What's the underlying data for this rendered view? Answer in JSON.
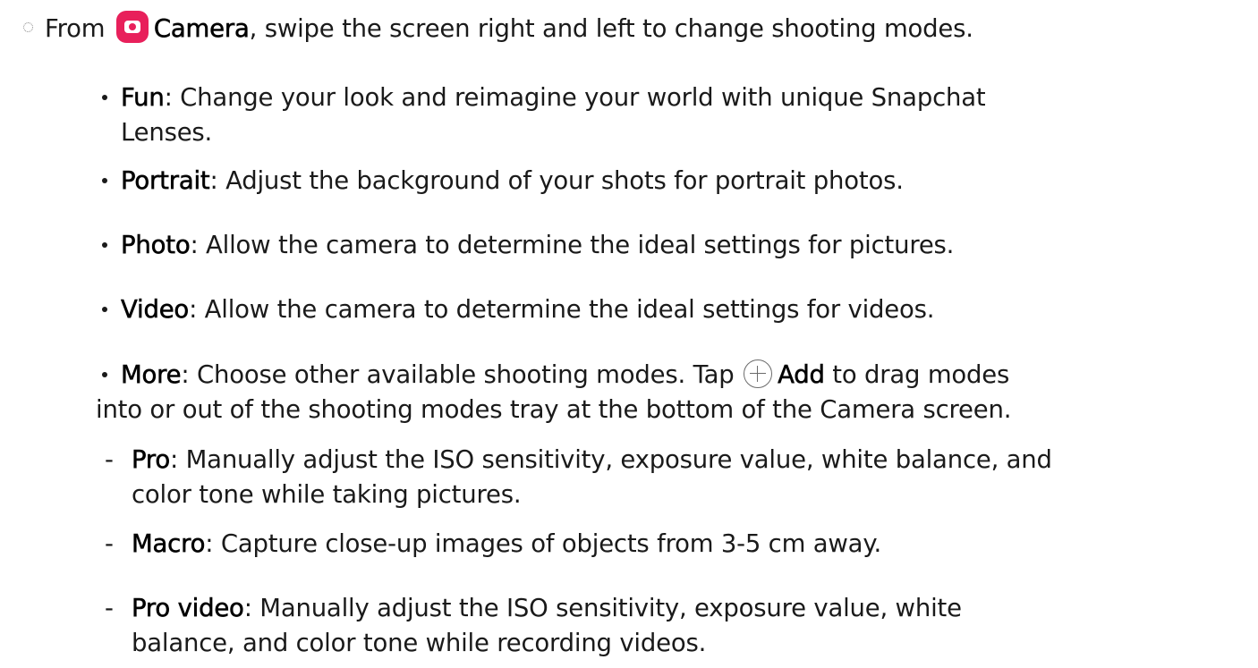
{
  "intro": {
    "prefix": "From",
    "app_icon": "camera-app-icon",
    "app_name": "Camera",
    "rest": ", swipe the screen right and left to change shooting modes."
  },
  "modes": [
    {
      "term": "Fun",
      "desc_line1": ": Change your look and reimagine your world with unique Snapchat",
      "desc_line2": "Lenses."
    },
    {
      "term": "Portrait",
      "desc_line1": ": Adjust the background of your shots for portrait photos."
    },
    {
      "term": "Photo",
      "desc_line1": ": Allow the camera to determine the ideal settings for pictures."
    },
    {
      "term": "Video",
      "desc_line1": ": Allow the camera to determine the ideal settings for videos."
    },
    {
      "term": "More",
      "desc_pre_icon": ": Choose other available shooting modes. Tap",
      "icon": "add-circle-icon",
      "icon_label": "Add",
      "desc_post_icon": " to drag modes",
      "desc_line2": "into or out of the shooting modes tray at the bottom of the Camera screen."
    }
  ],
  "sub_modes": [
    {
      "term": "Pro",
      "desc_line1": ": Manually adjust the ISO sensitivity, exposure value, white balance, and",
      "desc_line2": "color tone while taking pictures."
    },
    {
      "term": "Macro",
      "desc_line1": ": Capture close-up images of objects from 3-5 cm away."
    },
    {
      "term": "Pro video",
      "desc_line1": ": Manually adjust the ISO sensitivity, exposure value, white",
      "desc_line2": "balance, and color tone while recording videos."
    }
  ],
  "sub_bullet_char": "-"
}
